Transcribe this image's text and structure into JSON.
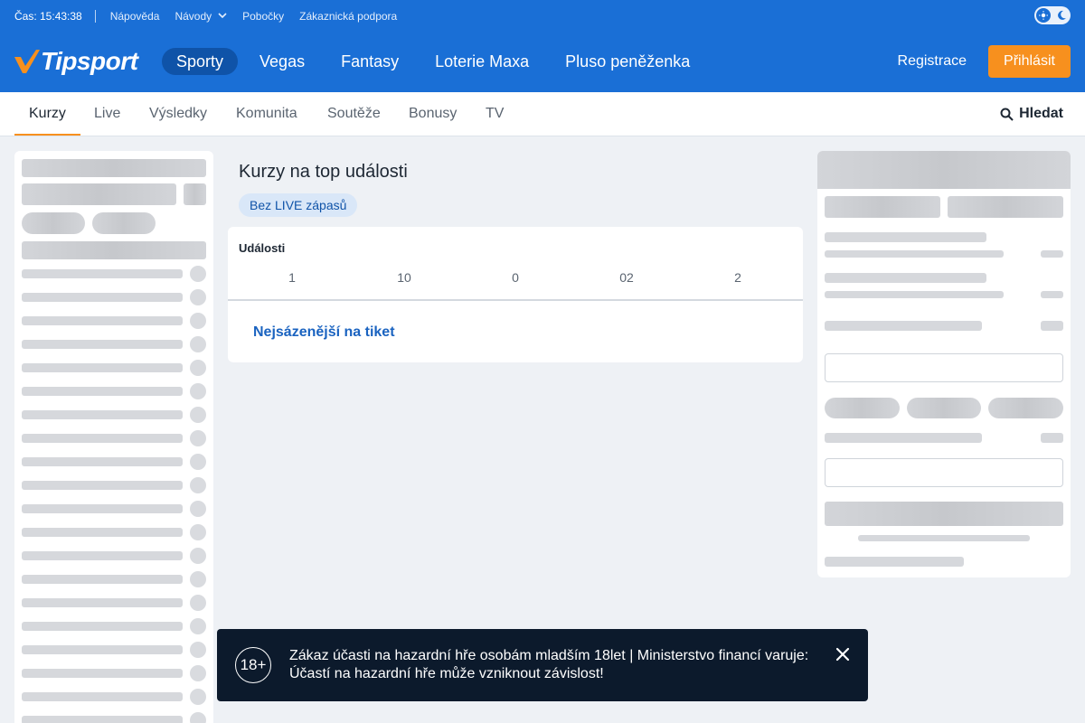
{
  "topbar": {
    "time": "Čas: 15:43:38",
    "links": [
      "Nápověda",
      "Návody",
      "Pobočky",
      "Zákaznická podpora"
    ]
  },
  "header": {
    "logo": "Tipsport",
    "nav": [
      "Sporty",
      "Vegas",
      "Fantasy",
      "Loterie Maxa",
      "Pluso peněženka"
    ],
    "active_nav": "Sporty",
    "register": "Registrace",
    "login": "Přihlásit"
  },
  "subnav": {
    "items": [
      "Kurzy",
      "Live",
      "Výsledky",
      "Komunita",
      "Soutěže",
      "Bonusy",
      "TV"
    ],
    "active": "Kurzy",
    "search": "Hledat"
  },
  "main": {
    "title": "Kurzy na top události",
    "chip": "Bez LIVE zápasů",
    "events_label": "Události",
    "columns": [
      "1",
      "10",
      "0",
      "02",
      "2"
    ],
    "most_bet_link": "Nejsázenější na tiket"
  },
  "notice": {
    "age": "18+",
    "message": "Zákaz účasti na hazardní hře osobám mladším 18let | Ministerstvo financí varuje: Účastí na hazardní hře může vzniknout závislost!"
  },
  "colors": {
    "brand_blue": "#1a6fd6",
    "active_nav_bg": "#0f53a8",
    "accent_orange": "#f7901e",
    "notice_bg": "#0c1a2c"
  }
}
